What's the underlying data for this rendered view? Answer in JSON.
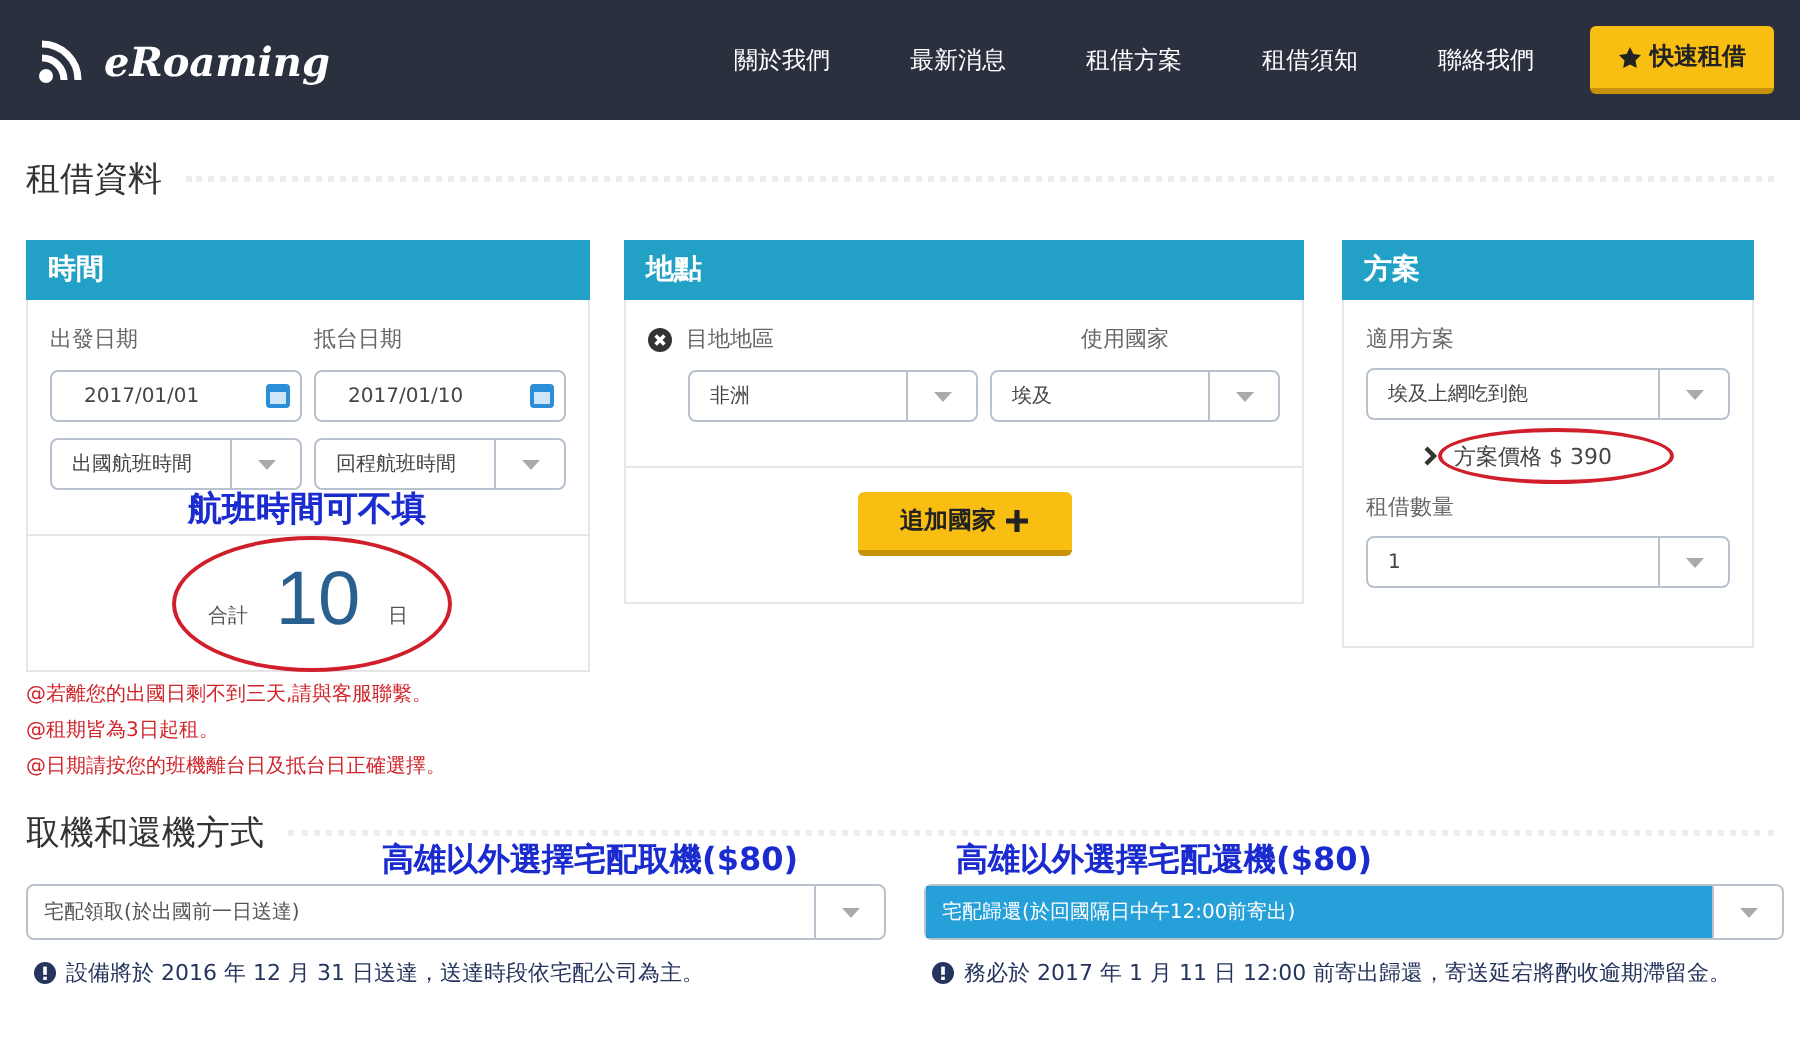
{
  "header": {
    "logo": "eRoaming",
    "nav": [
      "關於我們",
      "最新消息",
      "租借方案",
      "租借須知",
      "聯絡我們"
    ],
    "cta": "快速租借"
  },
  "section_title": "租借資料",
  "time_panel": {
    "title": "時間",
    "depart_label": "出發日期",
    "return_label": "抵台日期",
    "depart_date": "2017/01/01",
    "return_date": "2017/01/10",
    "depart_flight": "出國航班時間",
    "return_flight": "回程航班時間",
    "total_label": "合計",
    "total": "10",
    "unit": "日",
    "annotation": "航班時間可不填"
  },
  "location_panel": {
    "title": "地點",
    "region_label": "目地地區",
    "country_label": "使用國家",
    "region": "非洲",
    "country": "埃及",
    "add_button": "追加國家"
  },
  "plan_panel": {
    "title": "方案",
    "plan_label": "適用方案",
    "plan": "埃及上網吃到飽",
    "price": "方案價格 $ 390",
    "quantity_label": "租借數量",
    "quantity": "1"
  },
  "notes": [
    "@若離您的出國日剩不到三天,請與客服聯繫。",
    "@租期皆為3日起租。",
    "@日期請按您的班機離台日及抵台日正確選擇。"
  ],
  "delivery_title": "取機和還機方式",
  "delivery": [
    {
      "annotation": "高雄以外選擇宅配取機($80)",
      "value": "宅配領取(於出國前一日送達)",
      "highlighted": false,
      "note": "設備將於 2016 年 12 月 31 日送達，送達時段依宅配公司為主。"
    },
    {
      "annotation": "高雄以外選擇宅配還機($80)",
      "value": "宅配歸還(於回國隔日中午12:00前寄出)",
      "highlighted": true,
      "note": "務必於 2017 年 1 月 11 日 12:00 前寄出歸還，寄送延宕將酌收逾期滯留金。"
    }
  ]
}
